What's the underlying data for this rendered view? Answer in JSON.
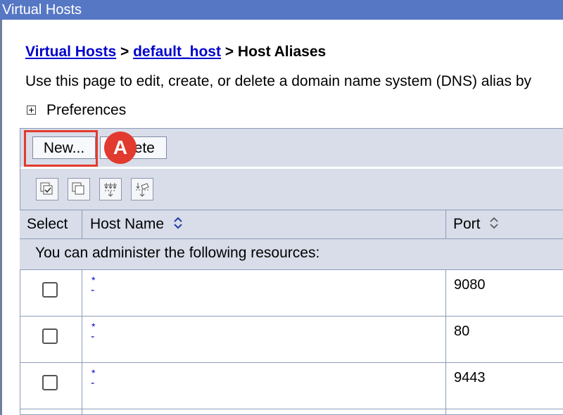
{
  "window": {
    "title": "Virtual Hosts"
  },
  "breadcrumb": {
    "items": [
      "Virtual Hosts",
      "default_host"
    ],
    "separator": ">",
    "current": "Host Aliases"
  },
  "description": "Use this page to edit, create, or delete a domain name system (DNS) alias by",
  "preferences": {
    "label": "Preferences"
  },
  "buttons": {
    "new": "New...",
    "delete": "Delete"
  },
  "annotation": {
    "marker": "A",
    "color": "#e23a2e"
  },
  "table_icons": [
    "select-all-icon",
    "deselect-all-icon",
    "show-filter-icon",
    "clear-filter-icon"
  ],
  "table": {
    "headers": {
      "select": "Select",
      "host_name": "Host Name",
      "port": "Port"
    },
    "resource_message": "You can administer the following resources:",
    "rows": [
      {
        "host_name": "*",
        "port": "9080"
      },
      {
        "host_name": "*",
        "port": "80"
      },
      {
        "host_name": "*",
        "port": "9443"
      }
    ]
  },
  "colors": {
    "title_bar": "#5677c4",
    "header_bg": "#d8dde9",
    "link": "#0000cc"
  }
}
